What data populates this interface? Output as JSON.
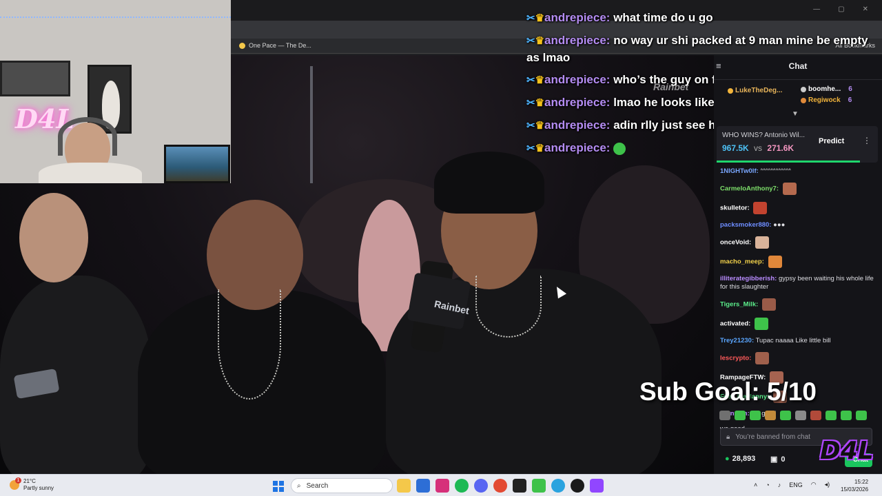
{
  "browser": {
    "bookmark_tab": "One Pace — The De...",
    "all_bookmarks": "All Bookmarks"
  },
  "overlay": {
    "stream_logo": "D4L",
    "watermark": "Rainbet",
    "mic_brand": "Rainbet",
    "messages": [
      {
        "user": "andrepiece:",
        "text": "what time do u go"
      },
      {
        "user": "andrepiece:",
        "text": "no way ur shi packed at 9 man mine be empty as lmao"
      },
      {
        "user": "andrepiece:",
        "text": "who’s the guy on far left"
      },
      {
        "user": "andrepiece:",
        "text": "lmao he looks like a kid"
      },
      {
        "user": "andrepiece:",
        "text": "adin rlly just see he’s poor"
      },
      {
        "user": "andrepiece:",
        "text": ""
      }
    ],
    "sub_goal": "Sub Goal: 5/10"
  },
  "chat": {
    "title": "Chat",
    "leaders": [
      {
        "name": "LukeTheDeg...",
        "count": ""
      },
      {
        "name": "boomhe...",
        "count": "6"
      },
      {
        "name": "Regiwock",
        "count": "6"
      }
    ],
    "prediction": {
      "question": "WHO WINS? Antonio Wil...",
      "value_a": "967.5K",
      "vs": "vs",
      "value_b": "271.6K",
      "button": "Predict"
    },
    "messages": [
      {
        "user": "1NIGHTw0lf:",
        "color": "#7aa7ff",
        "text": "ᐢᐢᐢᐢᐢᐢᐢᐢᐢᐢᐢᐢ",
        "emote": ""
      },
      {
        "user": "CarmeloAnthony7:",
        "color": "#7ee06b",
        "text": "",
        "emote": "#b56a4e"
      },
      {
        "user": "skulletor:",
        "color": "#ffffff",
        "text": "",
        "emote": "#c2432f"
      },
      {
        "user": "packsmoker880:",
        "color": "#6d8dff",
        "text": "●●●",
        "emote": ""
      },
      {
        "user": "onceVoid:",
        "color": "#ffffff",
        "text": "",
        "emote": "#d9b39a"
      },
      {
        "user": "macho_meep:",
        "color": "#f2d14a",
        "text": "",
        "emote": "#e0873a"
      },
      {
        "user": "illiterategibberish:",
        "color": "#b98cff",
        "text": "gypsy been waiting his whole life for this slaughter",
        "emote": ""
      },
      {
        "user": "Tigers_Milk:",
        "color": "#5cf08c",
        "text": "",
        "emote": "#9a5b48"
      },
      {
        "user": "activated:",
        "color": "#ffffff",
        "text": "",
        "emote": "#3ec24a"
      },
      {
        "user": "Trey21230:",
        "color": "#5aa6ff",
        "text": "Tupac naaaa Like little bill",
        "emote": ""
      },
      {
        "user": "lescrypto:",
        "color": "#ff5a5a",
        "text": "",
        "emote": "#a0604c"
      },
      {
        "user": "RampageFTW:",
        "color": "#ffffff",
        "text": "",
        "emote": "#a66350"
      },
      {
        "user": "FeelLikeManny:",
        "color": "#5cf08c",
        "text": "",
        "emote": "#9c5f4d"
      },
      {
        "user": "branxam:",
        "color": "#b98cff",
        "text": "we good",
        "emote": ""
      },
      {
        "user": "",
        "color": "#ffffff",
        "text": "we good",
        "emote": ""
      }
    ],
    "banned_text": "You’re banned from chat",
    "points": "28,893",
    "gifts": "0",
    "chat_button": "Chat"
  },
  "taskbar": {
    "temperature": "21°C",
    "weather": "Partly sunny",
    "weather_badge": "1",
    "search": "Search",
    "language": "ENG",
    "time": "15:22",
    "date": "15/03/2026"
  },
  "colors": {
    "accent_green": "#1ac65e",
    "username_purple": "#b48cf2",
    "taskbar_bg": "#e8eaf0"
  }
}
